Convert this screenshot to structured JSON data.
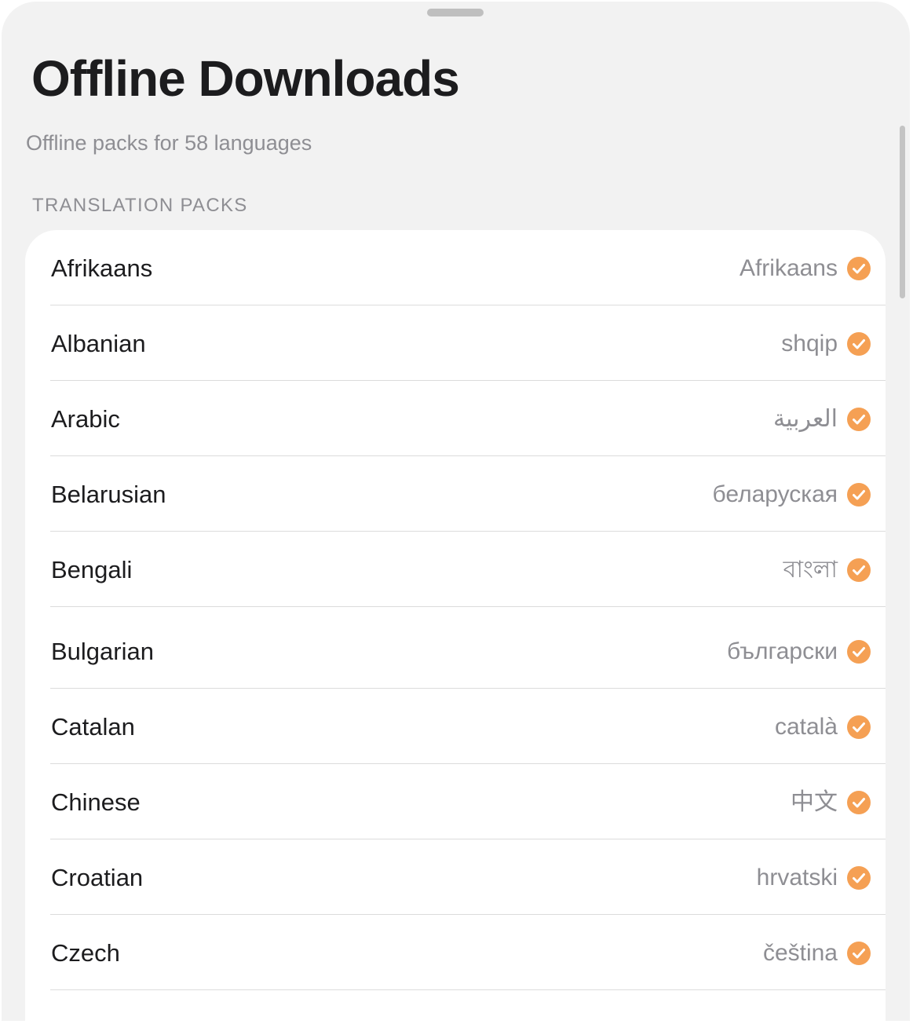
{
  "header": {
    "title": "Offline Downloads",
    "subtitle": "Offline packs for 58 languages",
    "section_label": "TRANSLATION PACKS"
  },
  "accent_color": "#f5a054",
  "status_icon": "checkmark-circle-icon",
  "languages": [
    {
      "name": "Afrikaans",
      "native": "Afrikaans",
      "downloaded": true
    },
    {
      "name": "Albanian",
      "native": "shqip",
      "downloaded": true
    },
    {
      "name": "Arabic",
      "native": "العربية",
      "downloaded": true
    },
    {
      "name": "Belarusian",
      "native": "беларуская",
      "downloaded": true
    },
    {
      "name": "Bengali",
      "native": "বাংলা",
      "downloaded": true
    },
    {
      "name": "Bulgarian",
      "native": "български",
      "downloaded": true
    },
    {
      "name": "Catalan",
      "native": "català",
      "downloaded": true
    },
    {
      "name": "Chinese",
      "native": "中文",
      "downloaded": true
    },
    {
      "name": "Croatian",
      "native": "hrvatski",
      "downloaded": true
    },
    {
      "name": "Czech",
      "native": "čeština",
      "downloaded": true
    }
  ]
}
